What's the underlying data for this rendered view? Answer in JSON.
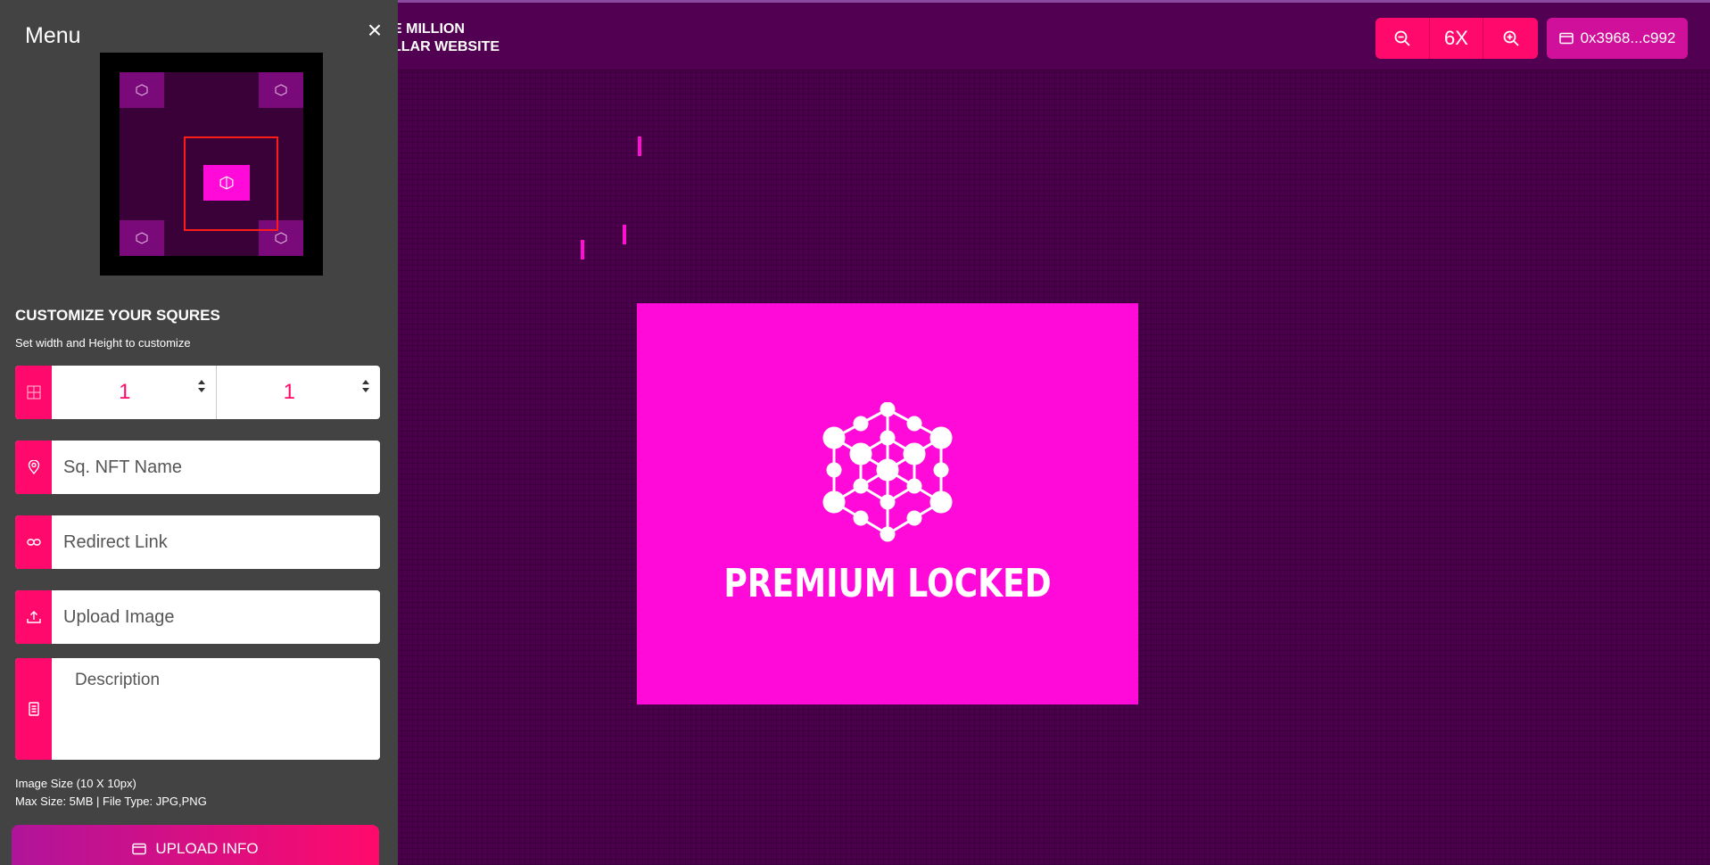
{
  "header": {
    "logo_line1": "E MILLION",
    "logo_line2": "LLAR WEBSITE",
    "zoom_level": "6X",
    "wallet_address": "0x3968...c992"
  },
  "canvas": {
    "premium_label": "PREMIUM LOCKED"
  },
  "sidebar": {
    "menu_title": "Menu",
    "close_glyph": "×",
    "section_title": "CUSTOMIZE YOUR SQURES",
    "section_subtitle": "Set width and Height to customize",
    "width_value": "1",
    "height_value": "1",
    "nft_name_placeholder": "Sq. NFT Name",
    "redirect_placeholder": "Redirect Link",
    "upload_placeholder": "Upload Image",
    "description_placeholder": "Description",
    "image_size_info": "Image Size (10 X 10px)",
    "max_size_info": "Max Size: 5MB | File Type: JPG,PNG",
    "upload_button_label": "UPLOAD INFO"
  },
  "colors": {
    "accent": "#ff0a6c",
    "premium": "#ff0ad9",
    "sidebar_bg": "#434343",
    "canvas_bg": "#4b004b"
  },
  "icons": {
    "zoom_out": "zoom-out-icon",
    "zoom_in": "zoom-in-icon",
    "wallet": "wallet-icon",
    "grid": "grid-icon",
    "location": "location-pin-icon",
    "link": "link-icon",
    "upload": "upload-icon",
    "document": "document-icon",
    "cube": "cube-network-icon"
  }
}
